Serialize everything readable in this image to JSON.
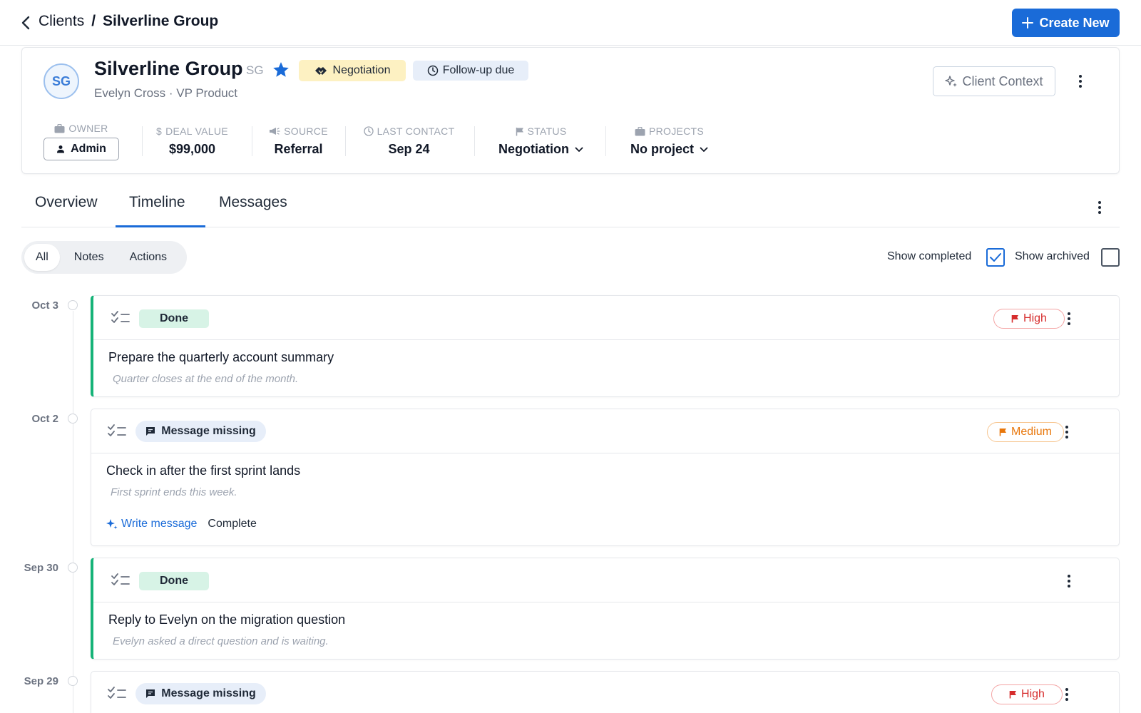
{
  "breadcrumb": {
    "parent": "Clients",
    "separator": "/",
    "current": "Silverline Group"
  },
  "header": {
    "create_label": "Create New"
  },
  "client": {
    "avatar_initials": "SG",
    "name": "Silverline Group",
    "initials": "SG",
    "starred": true,
    "stage_badge": "Negotiation",
    "followup_badge": "Follow-up due",
    "subtitle": "Evelyn Cross · VP Product",
    "context_button": "Client Context"
  },
  "stats": {
    "owner": {
      "label": "OWNER",
      "value": "Admin"
    },
    "deal_value": {
      "label": "DEAL VALUE",
      "value": "$99,000"
    },
    "source": {
      "label": "SOURCE",
      "value": "Referral"
    },
    "last_contact": {
      "label": "LAST CONTACT",
      "value": "Sep 24"
    },
    "status": {
      "label": "STATUS",
      "value": "Negotiation"
    },
    "projects": {
      "label": "PROJECTS",
      "value": "No project"
    }
  },
  "tabs": [
    {
      "label": "Overview",
      "active": false
    },
    {
      "label": "Timeline",
      "active": true
    },
    {
      "label": "Messages",
      "active": false
    }
  ],
  "filters": {
    "segments": [
      "All",
      "Notes",
      "Actions"
    ],
    "active_segment": "All",
    "show_completed": {
      "label": "Show completed",
      "checked": true
    },
    "show_archived": {
      "label": "Show archived",
      "checked": false
    }
  },
  "timeline": [
    {
      "date": "Oct 3",
      "status": "Done",
      "priority": "High",
      "title": "Prepare the quarterly account summary",
      "note": "Quarter closes at the end of the month."
    },
    {
      "date": "Oct 2",
      "status": "Message missing",
      "priority": "Medium",
      "title": "Check in after the first sprint lands",
      "note": "First sprint ends this week.",
      "actions": {
        "write": "Write message",
        "complete": "Complete"
      }
    },
    {
      "date": "Sep 30",
      "status": "Done",
      "priority": "",
      "title": "Reply to Evelyn on the migration question",
      "note": "Evelyn asked a direct question and is waiting."
    },
    {
      "date": "Sep 29",
      "status": "Message missing",
      "priority": "High"
    }
  ],
  "colors": {
    "accent": "#1a6bd8",
    "done_green": "#16b378",
    "high_red": "#d62d2d",
    "medium_orange": "#e8770c",
    "negotiation_bg": "#fdf1c2"
  }
}
